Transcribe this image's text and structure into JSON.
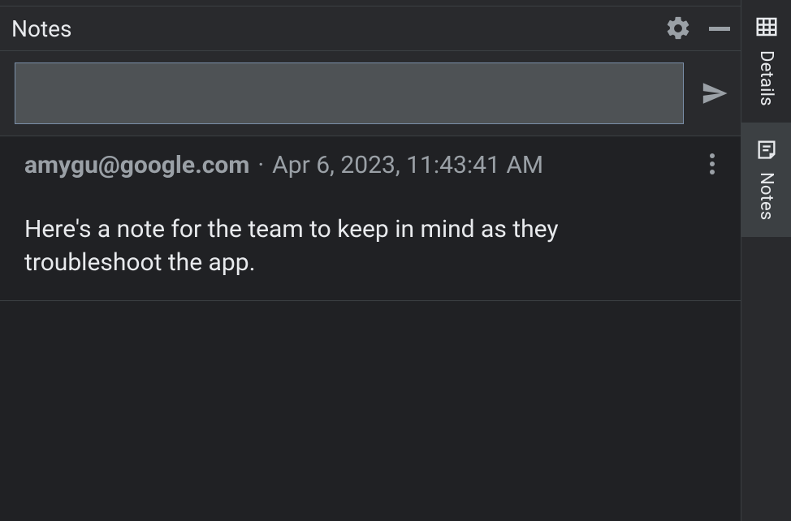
{
  "panel": {
    "title": "Notes"
  },
  "compose": {
    "value": "",
    "placeholder": ""
  },
  "notes": [
    {
      "author": "amygu@google.com",
      "separator": "·",
      "timestamp": "Apr 6, 2023, 11:43:41 AM",
      "body": "Here's a note for the team to keep in mind as they troubleshoot the app."
    }
  ],
  "sidebar": {
    "tabs": [
      {
        "label": "Details"
      },
      {
        "label": "Notes"
      }
    ]
  }
}
